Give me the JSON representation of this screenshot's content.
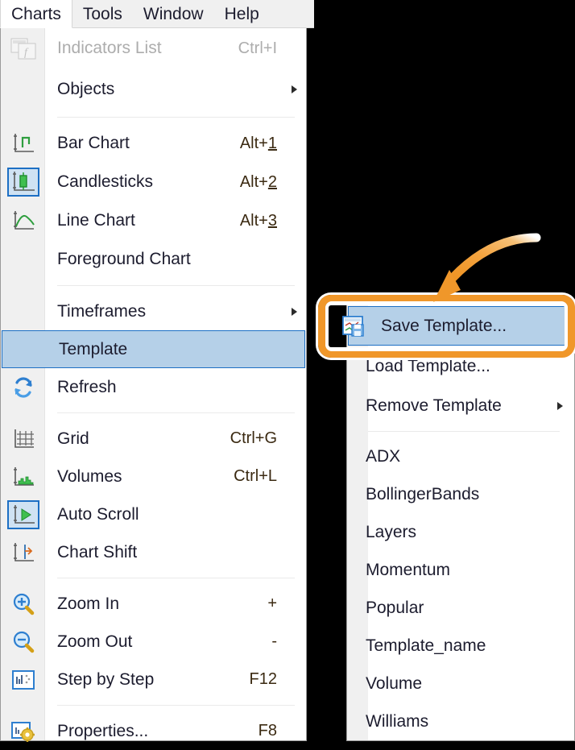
{
  "menubar": {
    "items": [
      {
        "label": "Charts",
        "active": true
      },
      {
        "label": "Tools",
        "active": false
      },
      {
        "label": "Window",
        "active": false
      },
      {
        "label": "Help",
        "active": false
      }
    ]
  },
  "charts_menu": {
    "items": [
      {
        "label": "Indicators List",
        "accel": "Ctrl+I",
        "icon": "indicators-list-icon",
        "disabled": true,
        "submenu": false,
        "selected": false
      },
      {
        "label": "Objects",
        "accel": "",
        "icon": "",
        "disabled": false,
        "submenu": true,
        "selected": false
      },
      {
        "separator_after": true
      },
      {
        "label": "Bar Chart",
        "accel": "Alt+1",
        "accel_underline": "1",
        "icon": "bar-chart-icon",
        "disabled": false,
        "submenu": false,
        "selected": false
      },
      {
        "label": "Candlesticks",
        "accel": "Alt+2",
        "accel_underline": "2",
        "icon": "candlesticks-icon",
        "disabled": false,
        "submenu": false,
        "selected": false,
        "icon_active": true
      },
      {
        "label": "Line Chart",
        "accel": "Alt+3",
        "accel_underline": "3",
        "icon": "line-chart-icon",
        "disabled": false,
        "submenu": false,
        "selected": false
      },
      {
        "label": "Foreground Chart",
        "accel": "",
        "icon": "",
        "disabled": false,
        "submenu": false,
        "selected": false
      },
      {
        "separator_after": true
      },
      {
        "label": "Timeframes",
        "accel": "",
        "icon": "",
        "disabled": false,
        "submenu": true,
        "selected": false
      },
      {
        "label": "Template",
        "accel": "",
        "icon": "",
        "disabled": false,
        "submenu": false,
        "selected": true
      },
      {
        "label": "Refresh",
        "accel": "",
        "icon": "refresh-icon",
        "disabled": false,
        "submenu": false,
        "selected": false
      },
      {
        "separator_after": true
      },
      {
        "label": "Grid",
        "accel": "Ctrl+G",
        "icon": "grid-icon",
        "disabled": false,
        "submenu": false,
        "selected": false
      },
      {
        "label": "Volumes",
        "accel": "Ctrl+L",
        "icon": "volumes-icon",
        "disabled": false,
        "submenu": false,
        "selected": false
      },
      {
        "label": "Auto Scroll",
        "accel": "",
        "icon": "auto-scroll-icon",
        "disabled": false,
        "submenu": false,
        "selected": false,
        "icon_active": true
      },
      {
        "label": "Chart Shift",
        "accel": "",
        "icon": "chart-shift-icon",
        "disabled": false,
        "submenu": false,
        "selected": false
      },
      {
        "separator_after": true
      },
      {
        "label": "Zoom In",
        "accel": "+",
        "icon": "zoom-in-icon",
        "disabled": false,
        "submenu": false,
        "selected": false
      },
      {
        "label": "Zoom Out",
        "accel": "-",
        "icon": "zoom-out-icon",
        "disabled": false,
        "submenu": false,
        "selected": false
      },
      {
        "label": "Step by Step",
        "accel": "F12",
        "icon": "step-by-step-icon",
        "disabled": false,
        "submenu": false,
        "selected": false
      },
      {
        "separator_after": true
      },
      {
        "label": "Properties...",
        "accel": "F8",
        "icon": "properties-icon",
        "disabled": false,
        "submenu": false,
        "selected": false
      }
    ]
  },
  "template_submenu": {
    "items": [
      {
        "label": "Save Template...",
        "icon": "save-template-icon",
        "submenu": false,
        "selected": true
      },
      {
        "label": "Load Template...",
        "icon": "",
        "submenu": false,
        "selected": false
      },
      {
        "label": "Remove Template",
        "icon": "",
        "submenu": true,
        "selected": false
      },
      {
        "separator_after": true
      },
      {
        "label": "ADX",
        "icon": "",
        "submenu": false,
        "selected": false
      },
      {
        "label": "BollingerBands",
        "icon": "",
        "submenu": false,
        "selected": false
      },
      {
        "label": "Layers",
        "icon": "",
        "submenu": false,
        "selected": false
      },
      {
        "label": "Momentum",
        "icon": "",
        "submenu": false,
        "selected": false
      },
      {
        "label": "Popular",
        "icon": "",
        "submenu": false,
        "selected": false
      },
      {
        "label": "Template_name",
        "icon": "",
        "submenu": false,
        "selected": false
      },
      {
        "label": "Volume",
        "icon": "",
        "submenu": false,
        "selected": false
      },
      {
        "label": "Williams",
        "icon": "",
        "submenu": false,
        "selected": false
      }
    ]
  },
  "annotation": {
    "highlight_color": "#f0972a",
    "arrow_name": "orange-curved-arrow",
    "highlight_target": "Save Template..."
  },
  "colors": {
    "selection_fill": "#b5d0e8",
    "selection_border": "#1d6fc4",
    "gutter": "#f0f0f0",
    "menu_bg": "#ffffff",
    "text": "#1c1c2e",
    "disabled_text": "#adadad",
    "backdrop": "#000000"
  }
}
